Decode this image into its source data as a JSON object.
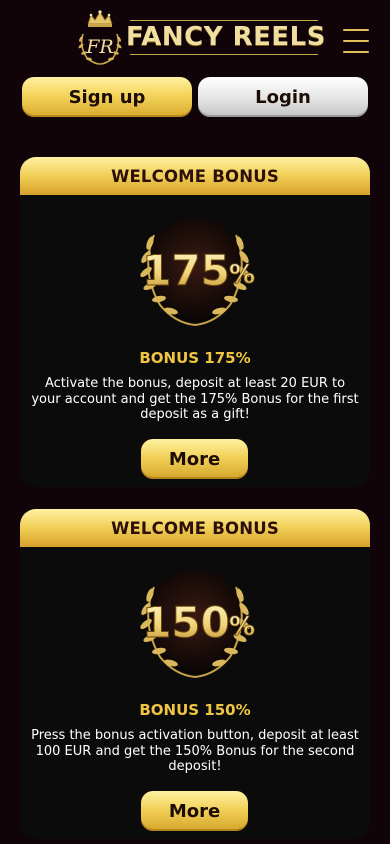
{
  "header": {
    "logo_text": "FANCY REELS",
    "logo_monogram": "FR",
    "menu_icon": "hamburger-menu-icon"
  },
  "auth": {
    "signup_label": "Sign up",
    "login_label": "Login"
  },
  "bonuses": [
    {
      "header": "WELCOME BONUS",
      "badge_value": "175",
      "badge_symbol": "%",
      "title": "BONUS 175%",
      "description": "Activate the bonus, deposit at least 20 EUR to your account and get the 175% Bonus for the first deposit as a gift!",
      "more_label": "More"
    },
    {
      "header": "WELCOME BONUS",
      "badge_value": "150",
      "badge_symbol": "%",
      "title": "BONUS 150%",
      "description": "Press the bonus activation button, deposit at least 100 EUR and get the 150% Bonus for the second deposit!",
      "more_label": "More"
    }
  ],
  "colors": {
    "background": "#100409",
    "card_background": "#0b0b0b",
    "gold": "#f0c540",
    "gold_light": "#fff2a2",
    "gold_dark": "#d4a42a",
    "button_text": "#1c0c06"
  }
}
